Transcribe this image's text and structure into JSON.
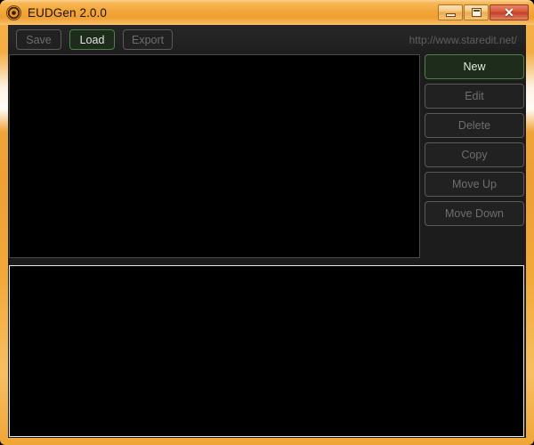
{
  "window": {
    "title": "EUDGen 2.0.0",
    "icon": "bullseye-icon",
    "accent_color": "#f2a738",
    "client_bg": "#1c1c1c"
  },
  "window_controls": [
    {
      "name": "minimize",
      "glyph": "–"
    },
    {
      "name": "maximize",
      "glyph": "□"
    },
    {
      "name": "close",
      "glyph": "✕"
    }
  ],
  "toolbar": {
    "buttons": [
      {
        "label": "Save",
        "enabled": false
      },
      {
        "label": "Load",
        "enabled": true
      },
      {
        "label": "Export",
        "enabled": false
      }
    ],
    "url": "http://www.staredit.net/"
  },
  "side_buttons": [
    {
      "label": "New",
      "enabled": true
    },
    {
      "label": "Edit",
      "enabled": false
    },
    {
      "label": "Delete",
      "enabled": false
    },
    {
      "label": "Copy",
      "enabled": false
    },
    {
      "label": "Move Up",
      "enabled": false
    },
    {
      "label": "Move Down",
      "enabled": false
    }
  ],
  "list_panel": {
    "items": [],
    "background": "#000000"
  },
  "bottom_panel": {
    "items": [],
    "background": "#000000"
  }
}
